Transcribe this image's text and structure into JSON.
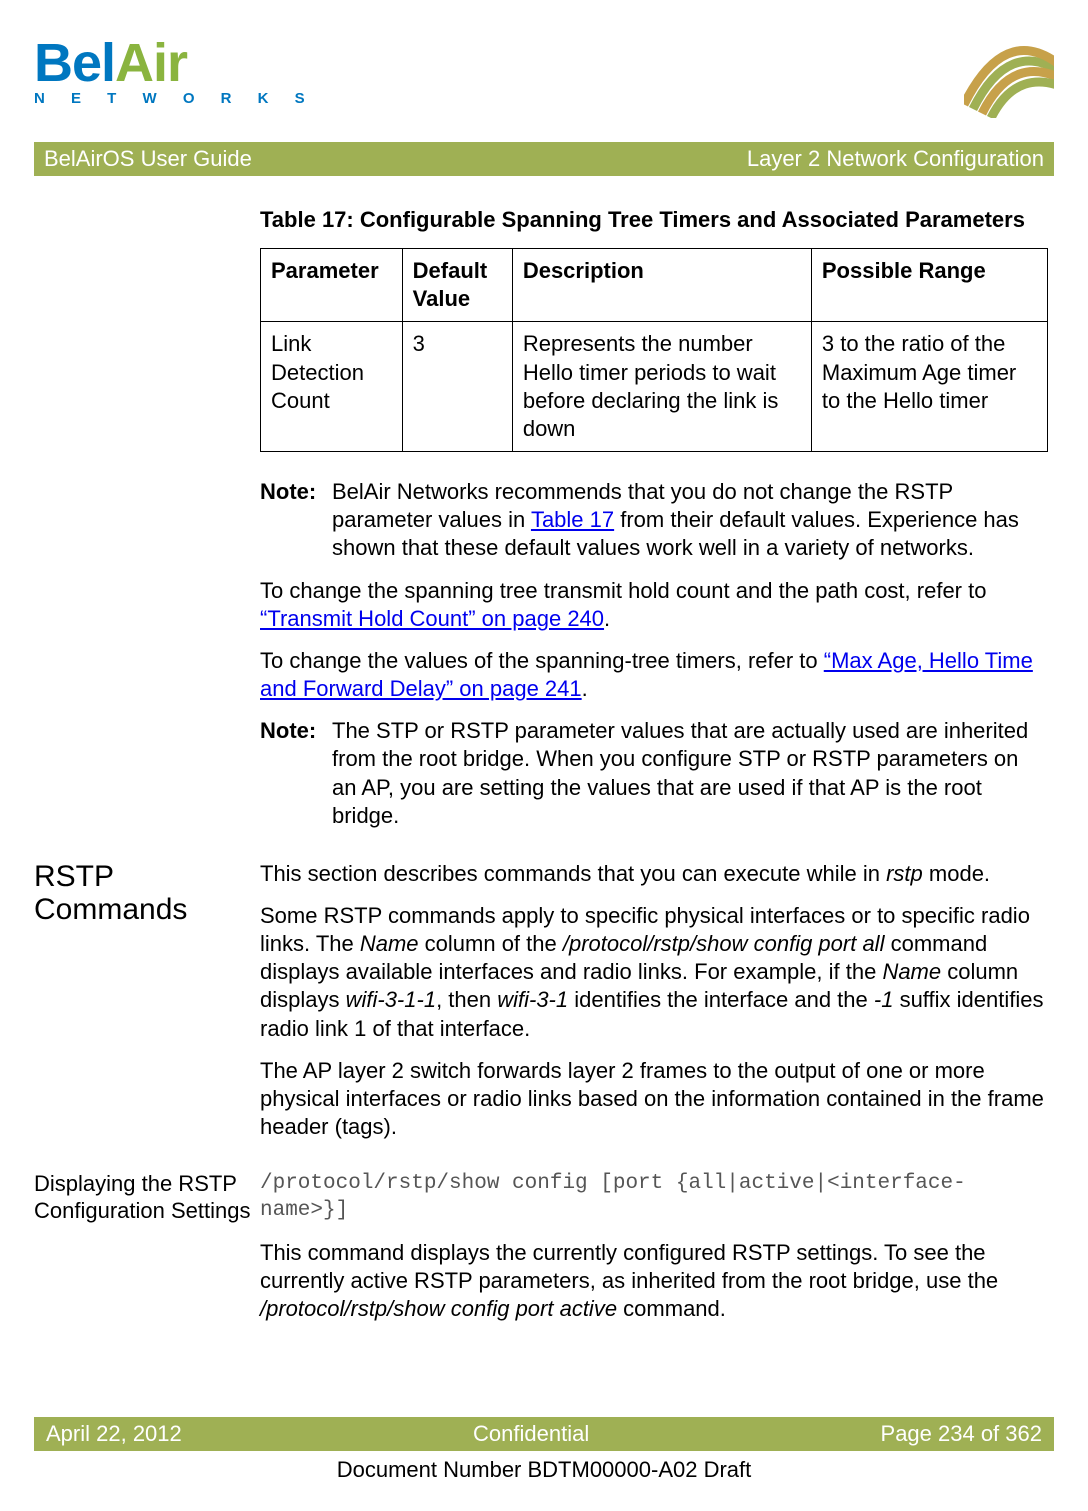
{
  "header": {
    "logo_bel": "Bel",
    "logo_air": "Air",
    "logo_networks": "N E T W O R K S"
  },
  "titlebar": {
    "left": "BelAirOS User Guide",
    "right": "Layer 2 Network Configuration"
  },
  "table": {
    "caption": "Table 17: Configurable Spanning Tree Timers and Associated Parameters",
    "headers": [
      "Parameter",
      "Default Value",
      "Description",
      "Possible Range"
    ],
    "row": {
      "param": "Link Detection Count",
      "default": "3",
      "desc": "Represents the number Hello timer periods to wait before declaring the link is down",
      "range": "3 to the ratio of the Maximum Age timer to the Hello timer"
    }
  },
  "note1": {
    "label": "Note:",
    "pre": "BelAir Networks recommends that you do not change the RSTP parameter values in ",
    "link": "Table 17",
    "post": " from their default values. Experience has shown that these default values work well in a variety of networks."
  },
  "para1": {
    "pre": "To change the spanning tree transmit hold count and the path cost, refer to ",
    "link": "“Transmit Hold Count” on page 240",
    "post": "."
  },
  "para2": {
    "pre": "To change the values of the spanning-tree timers, refer to ",
    "link": "“Max Age, Hello Time and Forward Delay” on page 241",
    "post": "."
  },
  "note2": {
    "label": "Note:",
    "body": "The STP or RSTP parameter values that are actually used are inherited from the root bridge. When you configure STP or RSTP parameters on an AP, you are setting the values that are used if that AP is the root bridge."
  },
  "section1": {
    "heading": "RSTP Commands",
    "p1a": "This section describes commands that you can execute while in ",
    "p1_italic": "rstp",
    "p1b": " mode.",
    "p2a": "Some RSTP commands apply to specific physical interfaces or to specific radio links. The ",
    "p2_i1": "Name",
    "p2b": " column of the ",
    "p2_i2": "/protocol/rstp/show config port all",
    "p2c": " command displays available interfaces and radio links. For example, if the ",
    "p2_i3": "Name",
    "p2d": " column displays ",
    "p2_i4": "wifi-3-1-1",
    "p2e": ", then ",
    "p2_i5": "wifi-3-1",
    "p2f": " identifies the interface and the ",
    "p2_i6": "-1",
    "p2g": " suffix identifies radio link 1 of that interface.",
    "p3": "The AP layer 2 switch forwards layer 2 frames to the output of one or more physical interfaces or radio links based on the information contained in the frame header (tags)."
  },
  "section2": {
    "heading": "Displaying the RSTP Configuration Settings",
    "code": "/protocol/rstp/show config [port {all|active|<interface-name>}]",
    "p1a": "This command displays the currently configured RSTP settings. To see the currently active RSTP parameters, as inherited from the root bridge, use the ",
    "p1_i1": "/protocol/rstp/show config port active",
    "p1b": " command."
  },
  "footer": {
    "left": "April 22, 2012",
    "center": "Confidential",
    "right": "Page 234 of 362"
  },
  "docnum": "Document Number BDTM00000-A02 Draft"
}
